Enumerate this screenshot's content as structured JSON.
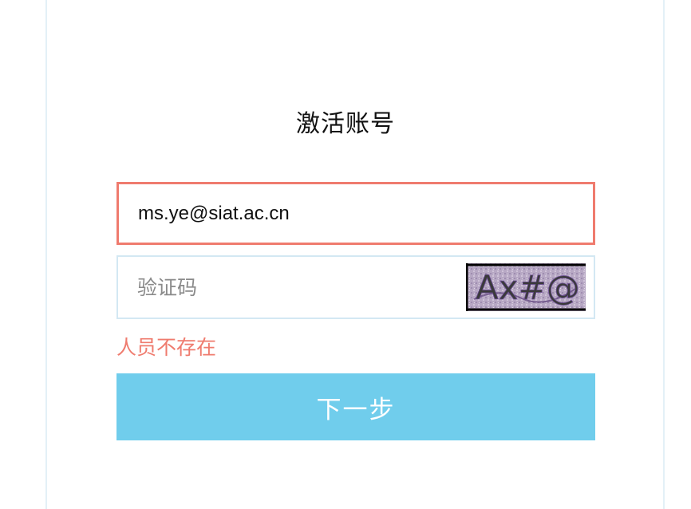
{
  "page": {
    "title": "激活账号"
  },
  "form": {
    "email_value": "ms.ye@siat.ac.cn",
    "captcha_placeholder": "验证码",
    "captcha_text": "Ax#@",
    "error_message": "人员不存在",
    "next_label": "下一步"
  },
  "colors": {
    "error": "#ef7b6e",
    "primary_button": "#70cdec",
    "input_border": "#d3e8f3",
    "panel_border": "#e3f0f7"
  }
}
